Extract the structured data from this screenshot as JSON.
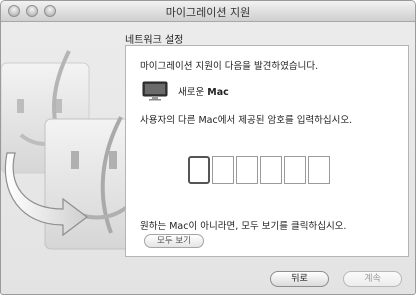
{
  "window": {
    "title": "마이그레이션 지원",
    "controls": [
      "close-button",
      "minimize-button",
      "zoom-button"
    ]
  },
  "section_title": "네트워크 설정",
  "panel": {
    "found_message": "마이그레이션 지원이 다음을 발견하였습니다.",
    "new_mac_prefix": "새로운 ",
    "new_mac_bold": "Mac",
    "instruction": "사용자의 다른 Mac에서 제공된 암호를 입력하십시오.",
    "code_boxes": [
      "",
      "",
      "",
      "",
      "",
      ""
    ],
    "hint": "원하는 Mac이 아니라면, 모두 보기를 클릭하십시오.",
    "show_all_label": "모두 보기"
  },
  "buttons": {
    "back_label": "뒤로",
    "continue_label": "계속"
  },
  "colors": {
    "window_bg": "#e6e6e6",
    "panel_bg": "#ffffff",
    "border": "#9a9a9a"
  }
}
